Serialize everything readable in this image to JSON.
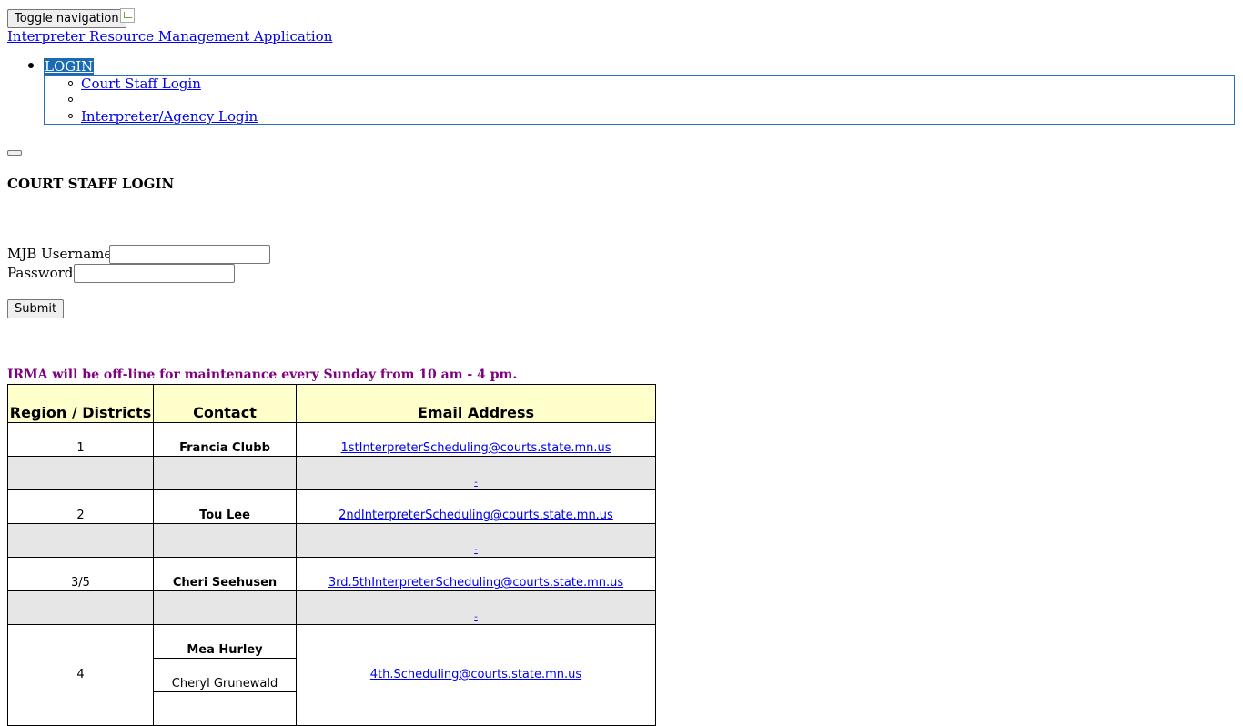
{
  "nav": {
    "toggle_label": "Toggle navigation",
    "app_title": "Interpreter Resource Management Application",
    "login_label": "LOGIN",
    "dropdown": {
      "court_staff_login": "Court Staff Login",
      "interpreter_agency_login": "Interpreter/Agency Login"
    }
  },
  "form": {
    "heading": "COURT STAFF LOGIN",
    "username_label": "MJB Username*",
    "username_value": "",
    "password_label": "Password*",
    "password_value": "",
    "submit_label": "Submit"
  },
  "notice": {
    "text": "IRMA will be off-line for maintenance every Sunday from 10 am - 4 pm.",
    "color": "#800080"
  },
  "table": {
    "headers": [
      "Region / Districts",
      "Contact",
      "Email Address"
    ],
    "header_bg": "#ffffcc",
    "rows": [
      {
        "region": "1",
        "contact": "Francia Clubb",
        "email": "1stInterpreterScheduling@courts.state.mn.us"
      },
      {
        "region": "2",
        "contact": "Tou Lee",
        "email": "2ndInterpreterScheduling@courts.state.mn.us"
      },
      {
        "region": "3/5",
        "contact": "Cheri Seehusen",
        "email": "3rd.5thInterpreterScheduling@courts.state.mn.us"
      },
      {
        "region": "4",
        "contacts": [
          "Mea Hurley",
          "Cheryl Grunewald"
        ],
        "email": "4th.Scheduling@courts.state.mn.us"
      }
    ],
    "spacer_mark": "-"
  },
  "colors": {
    "link": "#0000ee",
    "login_highlight": "#1a6bb4",
    "gray_row": "#e6e6e6"
  }
}
